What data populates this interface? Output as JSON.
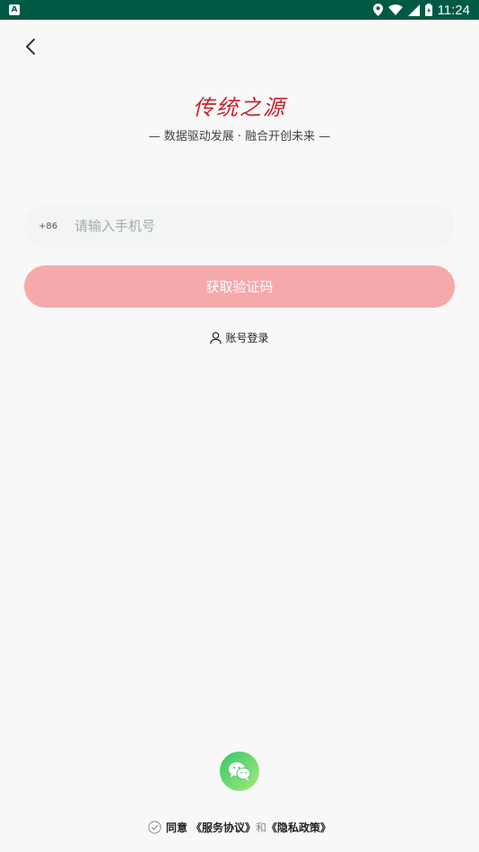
{
  "status_bar": {
    "time": "11:24",
    "app_icon_letter": "A"
  },
  "logo": {
    "text": "传统之源",
    "tagline": "— 数据驱动发展 · 融合开创未来 —"
  },
  "login": {
    "country_code": "+86",
    "phone_placeholder": "请输入手机号",
    "get_code_label": "获取验证码",
    "account_login_label": "账号登录"
  },
  "agreement": {
    "agree_label": "同意",
    "service_agreement": "《服务协议》",
    "and_label": "和",
    "privacy_policy": "《隐私政策》"
  },
  "colors": {
    "status_bar": "#005945",
    "brand_red": "#c4242f",
    "button_pink": "#f5a9aa",
    "wechat_green": "#37c66c"
  }
}
